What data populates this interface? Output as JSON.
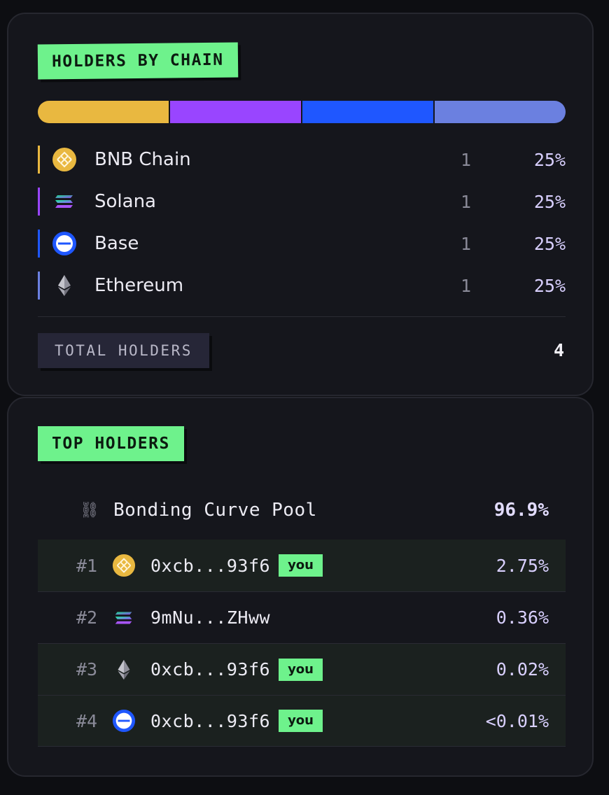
{
  "holders_by_chain": {
    "title": "HOLDERS BY CHAIN",
    "distribution": [
      {
        "chain": "BNB Chain",
        "fraction": 0.25,
        "color": "#e9b840"
      },
      {
        "chain": "Solana",
        "fraction": 0.25,
        "color": "#9945ff"
      },
      {
        "chain": "Base",
        "fraction": 0.25,
        "color": "#1f57ff"
      },
      {
        "chain": "Ethereum",
        "fraction": 0.25,
        "color": "#6b80e0"
      }
    ],
    "rows": [
      {
        "name": "BNB Chain",
        "count": "1",
        "percent": "25%",
        "icon": "bnb-icon",
        "color": "#e9b840"
      },
      {
        "name": "Solana",
        "count": "1",
        "percent": "25%",
        "icon": "solana-icon",
        "color": "#9945ff"
      },
      {
        "name": "Base",
        "count": "1",
        "percent": "25%",
        "icon": "base-icon",
        "color": "#1f57ff"
      },
      {
        "name": "Ethereum",
        "count": "1",
        "percent": "25%",
        "icon": "ethereum-icon",
        "color": "#6b80e0"
      }
    ],
    "total_label": "TOTAL HOLDERS",
    "total_value": "4"
  },
  "top_holders": {
    "title": "TOP HOLDERS",
    "pool": {
      "icon": "chain-link-icon",
      "label": "Bonding Curve Pool",
      "percent": "96.9%"
    },
    "rows": [
      {
        "rank": "#1",
        "chain_icon": "bnb-icon",
        "address": "0xcb...93f6",
        "badge": "you",
        "percent": "2.75%"
      },
      {
        "rank": "#2",
        "chain_icon": "solana-icon",
        "address": "9mNu...ZHww",
        "badge": "",
        "percent": "0.36%"
      },
      {
        "rank": "#3",
        "chain_icon": "ethereum-icon",
        "address": "0xcb...93f6",
        "badge": "you",
        "percent": "0.02%"
      },
      {
        "rank": "#4",
        "chain_icon": "base-icon",
        "address": "0xcb...93f6",
        "badge": "you",
        "percent": "<0.01%"
      }
    ]
  },
  "colors": {
    "accent_green": "#6ef28c",
    "card_bg": "#15161c",
    "page_bg": "#0d0e12"
  }
}
